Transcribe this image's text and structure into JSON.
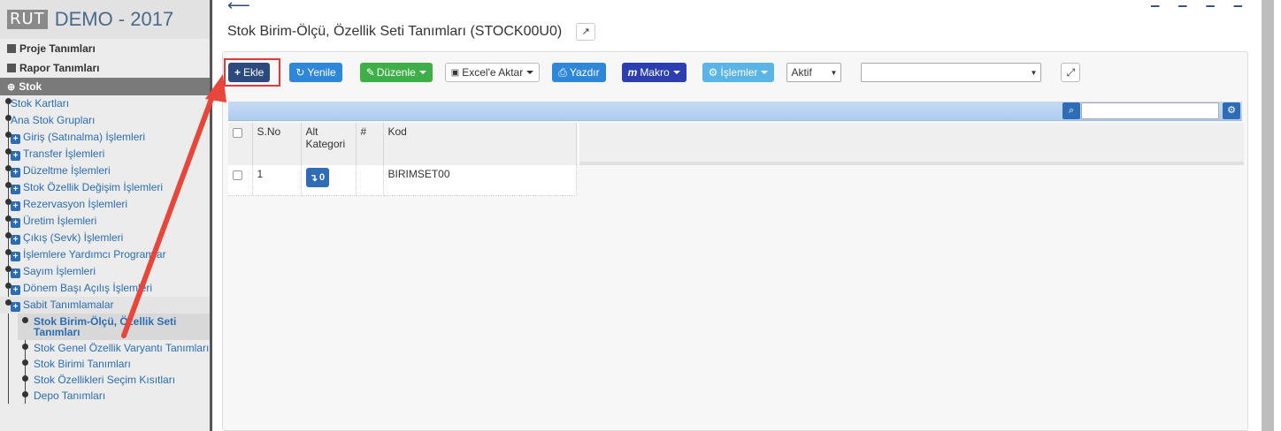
{
  "brand": {
    "logo": "RUT",
    "title": "DEMO - 2017"
  },
  "nav": {
    "proje": "Proje Tanımları",
    "rapor": "Rapor Tanımları",
    "section": "Stok"
  },
  "tree": {
    "items": [
      "Stok Kartları",
      "Ana Stok Grupları",
      "Giriş (Satınalma) İşlemleri",
      "Transfer İşlemleri",
      "Düzeltme İşlemleri",
      "Stok Özellik Değişim İşlemleri",
      "Rezervasyon İşlemleri",
      "Üretim İşlemleri",
      "Çıkış (Sevk) İşlemleri",
      "İşlemlere Yardımcı Programlar",
      "Sayım İşlemleri",
      "Dönem Başı Açılış İşlemleri",
      "Sabit Tanımlamalar"
    ],
    "sub": [
      "Stok Birim-Ölçü, Özellik Seti Tanımları",
      "Stok Genel Özellik Varyantı Tanımları",
      "Stok Birimi Tanımları",
      "Stok Özellikleri Seçim Kısıtları",
      "Depo Tanımları"
    ]
  },
  "page": {
    "title": "Stok Birim-Ölçü, Özellik Seti Tanımları (STOCK00U0)"
  },
  "toolbar": {
    "add": "Ekle",
    "refresh": "Yenile",
    "edit": "Düzenle",
    "excel": "Excel'e Aktar",
    "print": "Yazdır",
    "macro": "Makro",
    "actions": "İşlemler",
    "status_select": "Aktif",
    "filter_select": ""
  },
  "grid": {
    "headers": {
      "sno": "S.No",
      "alt": "Alt Kategori",
      "hash": "#",
      "kod": "Kod"
    },
    "rows": [
      {
        "sno": "1",
        "alt_count": "0",
        "kod": "BIRIMSET00"
      }
    ]
  },
  "colors": {
    "highlight": "#e03a3a",
    "navy": "#2c4a7e",
    "green": "#3eaf48"
  },
  "icons": [
    "back-arrow-icon",
    "external-link-icon",
    "plus-icon",
    "refresh-icon",
    "edit-icon",
    "excel-icon",
    "print-icon",
    "macro-icon",
    "gear-icon",
    "search-icon",
    "expand-icon",
    "cogs-icon"
  ]
}
